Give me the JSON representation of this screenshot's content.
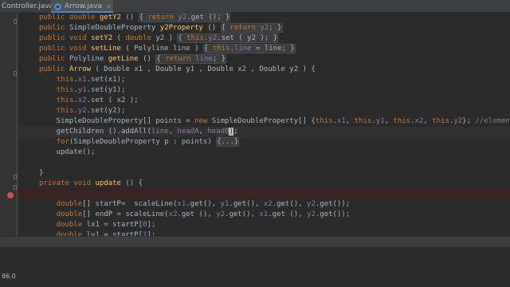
{
  "tabs": [
    {
      "label": "Controller.java",
      "active": false
    },
    {
      "label": "Arrow.java",
      "active": true
    }
  ],
  "code": [
    [
      "public double getY2 () { return y2.get (); }"
    ],
    [
      "public SimpleDoubleProperty y2Property () { return y2; }"
    ],
    [
      "public void setY2 ( double y2 ) { this.y2.set ( y2 ); }"
    ],
    [
      "public void setLine ( Polyline line ) { this.line = line; }"
    ],
    [
      "public Polyline getLine () { return line; }"
    ],
    [
      "public Arrow ( Double x1 , Double y1 , Double x2 , Double y2 ) {"
    ],
    [
      "this.x1.set(x1);"
    ],
    [
      "this.y1.set(y1);"
    ],
    [
      "this.x2.set ( x2 );"
    ],
    [
      "this.y2.set(y2);"
    ],
    [
      "SimpleDoubleProperty[] points = new SimpleDoubleProperty[] {this.x1, this.y1, this.x2, this.y2}; //elements should"
    ],
    [
      "getChildren ().addAll(line, headA, headB);"
    ],
    [
      "for(SimpleDoubleProperty p : points) {...}"
    ],
    [
      "update();"
    ],
    [
      ""
    ],
    [
      "}"
    ],
    [
      "private void update () {"
    ],
    [
      ""
    ],
    [
      "double[] startP=  scaleLine(x1.get(), y1.get(), x2.get(), y2.get());"
    ],
    [
      "double[] endP = scaleLine(x2.get (), y2.get(), x1.get (), y2.get());"
    ],
    [
      "double lx1 = startP[0];"
    ],
    [
      "double ly1 = startP[1];"
    ]
  ],
  "status": {
    "text": "86.0"
  }
}
